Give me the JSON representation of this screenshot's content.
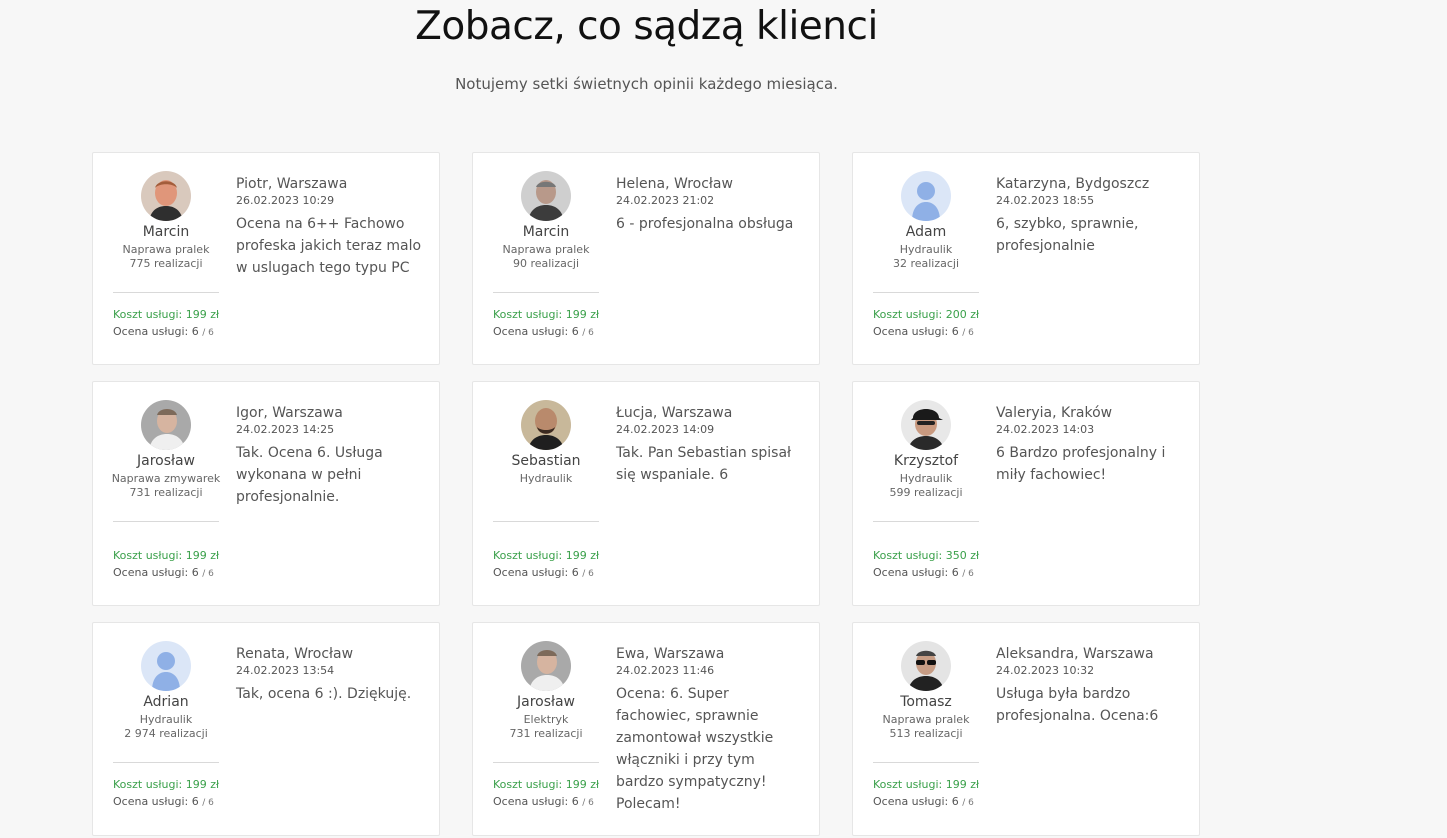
{
  "header": {
    "title": "Zobacz, co sądzą klienci",
    "subtitle": "Notujemy setki świetnych opinii każdego miesiąca."
  },
  "colors": {
    "accent_green": "#3aa04a",
    "avatar_placeholder_bg": "#dbe6f7",
    "avatar_placeholder_fg": "#8fb0e6"
  },
  "cards": [
    {
      "pro": {
        "name": "Marcin",
        "category": "Naprawa pralek",
        "realizations": "775 realizacji",
        "avatar": "photo-red"
      },
      "cost": "Koszt usługi: 199 zł",
      "rating": "Ocena usługi: 6",
      "rating_max": "/ 6",
      "author": "Piotr, Warszawa",
      "date": "26.02.2023 10:29",
      "text": "Ocena na 6++ Fachowo profeska jakich teraz malo w uslugach tego typu PC"
    },
    {
      "pro": {
        "name": "Marcin",
        "category": "Naprawa pralek",
        "realizations": "90 realizacji",
        "avatar": "photo-gray"
      },
      "cost": "Koszt usługi: 199 zł",
      "rating": "Ocena usługi: 6",
      "rating_max": "/ 6",
      "author": "Helena, Wrocław",
      "date": "24.02.2023 21:02",
      "text": "6 - profesjonalna obsługa"
    },
    {
      "pro": {
        "name": "Adam",
        "category": "Hydraulik",
        "realizations": "32 realizacji",
        "avatar": "placeholder"
      },
      "cost": "Koszt usługi: 200 zł",
      "rating": "Ocena usługi: 6",
      "rating_max": "/ 6",
      "author": "Katarzyna, Bydgoszcz",
      "date": "24.02.2023 18:55",
      "text": "6, szybko, sprawnie, profesjonalnie"
    },
    {
      "pro": {
        "name": "Jarosław",
        "category": "Naprawa zmywarek",
        "realizations": "731 realizacji",
        "avatar": "photo-light"
      },
      "cost": "Koszt usługi: 199 zł",
      "rating": "Ocena usługi: 6",
      "rating_max": "/ 6",
      "author": "Igor, Warszawa",
      "date": "24.02.2023 14:25",
      "text": "Tak. Ocena 6. Usługa wykonana w pełni profesjonalnie."
    },
    {
      "pro": {
        "name": "Sebastian",
        "category": "Hydraulik",
        "realizations": "",
        "avatar": "photo-dark"
      },
      "cost": "Koszt usługi: 199 zł",
      "rating": "Ocena usługi: 6",
      "rating_max": "/ 6",
      "author": "Łucja, Warszawa",
      "date": "24.02.2023 14:09",
      "text": "Tak. Pan Sebastian spisał się wspaniale. 6"
    },
    {
      "pro": {
        "name": "Krzysztof",
        "category": "Hydraulik",
        "realizations": "599 realizacji",
        "avatar": "photo-cap"
      },
      "cost": "Koszt usługi: 350 zł",
      "rating": "Ocena usługi: 6",
      "rating_max": "/ 6",
      "author": "Valeryia, Kraków",
      "date": "24.02.2023 14:03",
      "text": "6 Bardzo profesjonalny i miły fachowiec!"
    },
    {
      "pro": {
        "name": "Adrian",
        "category": "Hydraulik",
        "realizations": "2 974 realizacji",
        "avatar": "placeholder"
      },
      "cost": "Koszt usługi: 199 zł",
      "rating": "Ocena usługi: 6",
      "rating_max": "/ 6",
      "author": "Renata, Wrocław",
      "date": "24.02.2023 13:54",
      "text": "Tak, ocena 6 :). Dziękuję."
    },
    {
      "pro": {
        "name": "Jarosław",
        "category": "Elektryk",
        "realizations": "731 realizacji",
        "avatar": "photo-light"
      },
      "cost": "Koszt usługi: 199 zł",
      "rating": "Ocena usługi: 6",
      "rating_max": "/ 6",
      "author": "Ewa, Warszawa",
      "date": "24.02.2023 11:46",
      "text": "Ocena: 6. Super fachowiec, sprawnie zamontował wszystkie włączniki i przy tym bardzo sympatyczny! Polecam!"
    },
    {
      "pro": {
        "name": "Tomasz",
        "category": "Naprawa pralek",
        "realizations": "513 realizacji",
        "avatar": "photo-glasses"
      },
      "cost": "Koszt usługi: 199 zł",
      "rating": "Ocena usługi: 6",
      "rating_max": "/ 6",
      "author": "Aleksandra, Warszawa",
      "date": "24.02.2023 10:32",
      "text": "Usługa była bardzo profesjonalna. Ocena:6"
    }
  ]
}
